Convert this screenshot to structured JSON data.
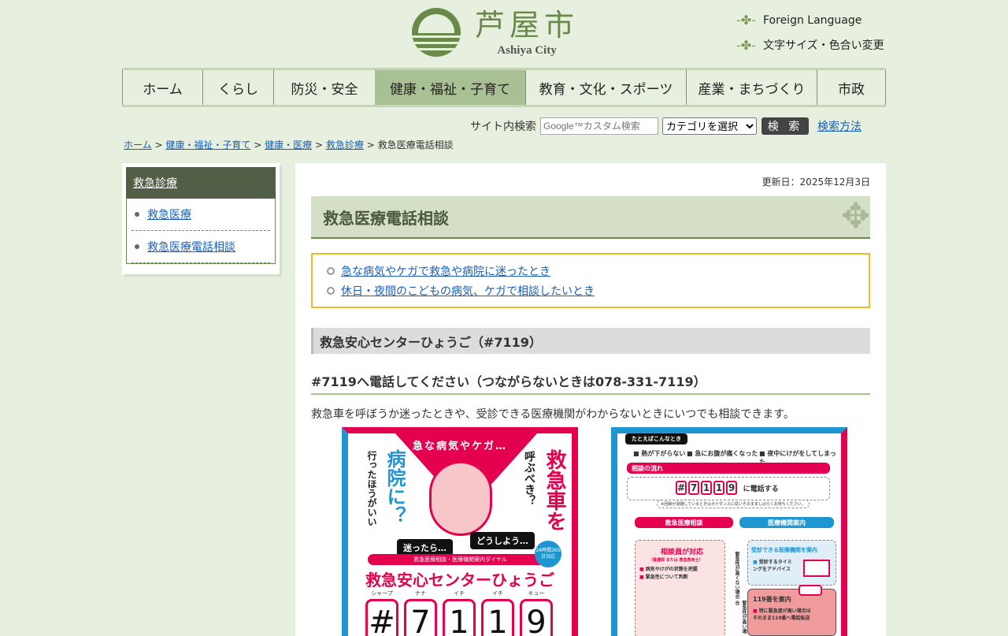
{
  "header": {
    "logo_jp": "芦屋市",
    "logo_en": "Ashiya City",
    "foreign_language": "Foreign Language",
    "text_size": "文字サイズ・色合い変更"
  },
  "nav": [
    {
      "label": "ホーム"
    },
    {
      "label": "くらし"
    },
    {
      "label": "防災・安全"
    },
    {
      "label": "健康・福祉・子育て",
      "active": true
    },
    {
      "label": "教育・文化・スポーツ"
    },
    {
      "label": "産業・まちづくり"
    },
    {
      "label": "市政"
    }
  ],
  "search": {
    "label": "サイト内検索",
    "placeholder": "Google™カスタム検索",
    "category": "カテゴリを選択",
    "button": "検 索",
    "help": "検索方法"
  },
  "breadcrumb": {
    "items": [
      "ホーム",
      "健康・福祉・子育て",
      "健康・医療",
      "救急診療"
    ],
    "sep": ">",
    "current": "救急医療電話相談"
  },
  "sidebar": {
    "title": "救急診療",
    "items": [
      "救急医療",
      "救急医療電話相談"
    ]
  },
  "main": {
    "updated": "更新日：2025年12月3日",
    "title": "救急医療電話相談",
    "toc": [
      "急な病気やケガで救急や病院に迷ったとき",
      "休日・夜間のこどもの病気、ケガで相談したいとき"
    ],
    "section": "救急安心センターひょうご（#7119）",
    "subsection": "#7119へ電話してください（つながらないときは078-331-7119）",
    "body": "救急車を呼ぼうか迷ったときや、受診できる医療機関がわからないときにいつでも相談できます。"
  },
  "poster1": {
    "top": "急な病気やケガ…",
    "left_small": "行ったほうがいい",
    "left_big": "病院に？",
    "right_small": "呼ぶべき？",
    "right_big": "救急車を",
    "bubble1": "迷ったら…",
    "bubble2": "どうしよう…",
    "bar": "救急医療相談・医療機関案内ダイヤル",
    "badge": "24時間365日対応",
    "center": "救急安心センターひょうご",
    "keys": [
      {
        "r": "シャープ",
        "k": "#"
      },
      {
        "r": "ナナ",
        "k": "7"
      },
      {
        "r": "イチ",
        "k": "1"
      },
      {
        "r": "イチ",
        "k": "1"
      },
      {
        "r": "キュー",
        "k": "9"
      }
    ]
  },
  "poster2": {
    "example_tag": "たとえばこんなとき",
    "examples": [
      "熱が下がらない",
      "急にお腹が痛くなった",
      "夜中にけがをしてしまった"
    ],
    "flow": "相談の流れ",
    "call_digits": [
      "#",
      "7",
      "1",
      "1",
      "9"
    ],
    "call": "に電話する",
    "note": "※回線が混雑しているときはガイダンスに従いそのまましばらくお待ちください。",
    "consult": "救急医療相談",
    "guide": "医療機関案内",
    "staff": "相談員が対応",
    "staff_sub": "（看護師 または 救急救命士）",
    "staff_items": [
      "病気やけがの状態を把握",
      "緊急性について判断"
    ],
    "low": "緊急性が高くない場合",
    "high": "緊急性が高い場合",
    "hospital": "受診できる医療機関を案内",
    "hospital_item": "受診するタイミングをアドバイス",
    "ambulance": "119番を案内",
    "ambulance_item": "特に緊急度が高い場合はそのまま119番へ電話転送"
  }
}
